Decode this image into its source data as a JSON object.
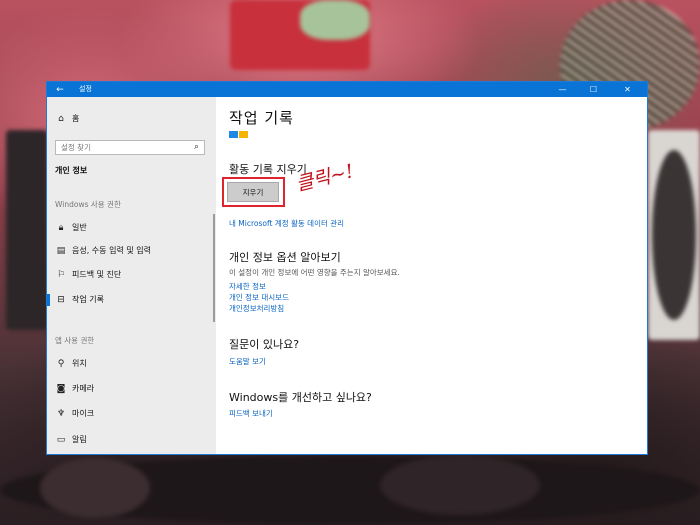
{
  "window": {
    "title": "설정",
    "back_icon": "←",
    "min_icon": "—",
    "max_icon": "☐",
    "close_icon": "✕"
  },
  "sidebar": {
    "home_label": "홈",
    "search_placeholder": "설정 찾기",
    "privacy_label": "개인 정보",
    "windows_section": "Windows 사용 권한",
    "windows_items": [
      {
        "label": "일반",
        "icon": "lock-icon"
      },
      {
        "label": "음성, 수동 입력 및 입력",
        "icon": "speech-icon"
      },
      {
        "label": "피드백 및 진단",
        "icon": "feedback-icon"
      },
      {
        "label": "작업 기록",
        "icon": "timeline-icon",
        "selected": true
      }
    ],
    "app_section": "앱 사용 권한",
    "app_items": [
      {
        "label": "위치",
        "icon": "location-icon"
      },
      {
        "label": "카메라",
        "icon": "camera-icon"
      },
      {
        "label": "마이크",
        "icon": "microphone-icon"
      },
      {
        "label": "알림",
        "icon": "notification-icon"
      }
    ]
  },
  "main": {
    "title": "작업 기록",
    "clear_heading": "활동 기록 지우기",
    "clear_button": "지우기",
    "manage_link": "내 Microsoft 계정 활동 데이터 관리",
    "privacy_heading": "개인 정보 옵션 알아보기",
    "privacy_desc": "이 설정이 개인 정보에 어떤 영향을 주는지 알아보세요.",
    "privacy_links": [
      "자세한 정보",
      "개인 정보 대시보드",
      "개인정보처리방침"
    ],
    "question_heading": "질문이 있나요?",
    "help_link": "도움말 보기",
    "improve_heading": "Windows를 개선하고 싶나요?",
    "feedback_link": "피드백 보내기"
  },
  "annotation": {
    "text": "클릭~!",
    "color": "#c0121b"
  },
  "colors": {
    "accent": "#0a74d6",
    "tile_blue": "#1e88e5",
    "tile_yellow": "#f5b400",
    "highlight": "#e0242d"
  }
}
